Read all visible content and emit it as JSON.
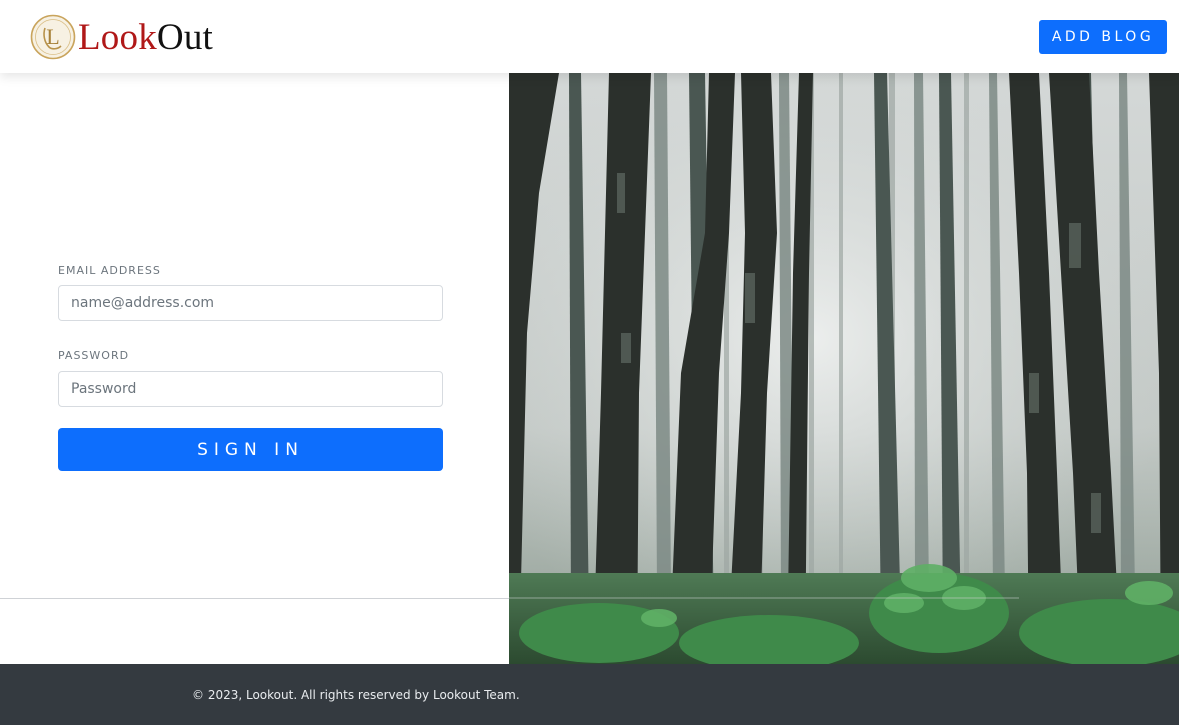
{
  "header": {
    "logo_monogram": "L",
    "logo_text_accent": "Look",
    "logo_text_rest": "Out",
    "add_blog_label": "ADD BLOG"
  },
  "login_form": {
    "email_label": "EMAIL ADDRESS",
    "email_placeholder": "name@address.com",
    "email_value": "",
    "password_label": "PASSWORD",
    "password_placeholder": "Password",
    "password_value": "",
    "signin_label": "SIGN IN"
  },
  "hero_image": {
    "subject": "misty forest with tall trees and green ferns"
  },
  "footer": {
    "copyright": "© 2023, Lookout. All rights reserved by Lookout Team."
  },
  "colors": {
    "primary": "#0d6efd",
    "footer_bg": "#343a40",
    "logo_accent": "#b01818"
  }
}
